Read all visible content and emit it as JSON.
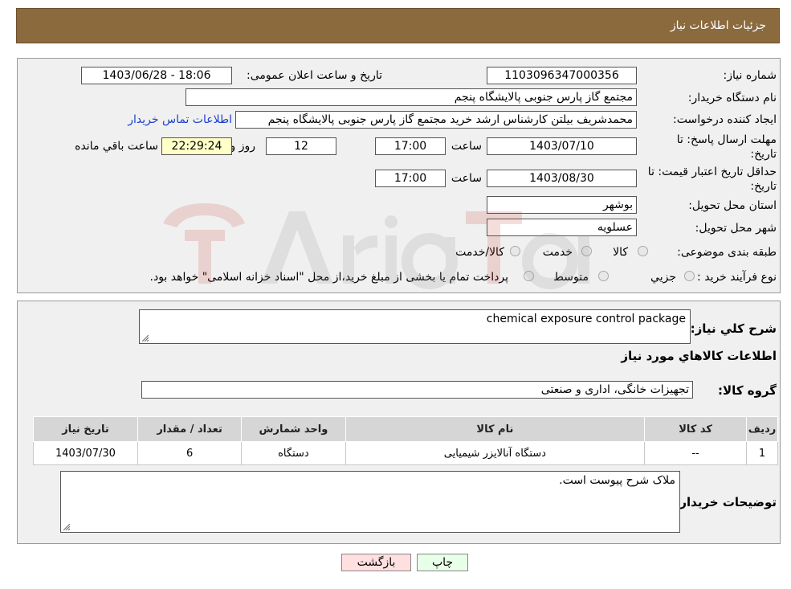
{
  "header": {
    "title": "جزئیات اطلاعات نیاز"
  },
  "form": {
    "need_number_label": "شماره نیاز:",
    "need_number": "1103096347000356",
    "announce_label": "تاریخ و ساعت اعلان عمومی:",
    "announce_value": "1403/06/28 - 18:06",
    "buyer_org_label": "نام دستگاه خریدار:",
    "buyer_org": "مجتمع گاز پارس جنوبی  پالایشگاه پنجم",
    "requester_label": "ایجاد کننده درخواست:",
    "requester": "محمدشریف بیلتن کارشناس ارشد خرید مجتمع گاز پارس جنوبی  پالایشگاه پنجم",
    "contact_link": "اطلاعات تماس خریدار",
    "deadline_label_1": "مهلت ارسال پاسخ: تا",
    "deadline_label_2": "تاریخ:",
    "deadline_date": "1403/07/10",
    "time_label": "ساعت",
    "deadline_time": "17:00",
    "days_value": "12",
    "days_label": "روز و",
    "remaining_time": "22:29:24",
    "remaining_label": "ساعت باقي مانده",
    "validity_label_1": "حداقل تاریخ اعتبار قیمت: تا",
    "validity_label_2": "تاریخ:",
    "validity_date": "1403/08/30",
    "validity_time": "17:00",
    "province_label": "استان محل تحویل:",
    "province": "بوشهر",
    "city_label": "شهر محل تحویل:",
    "city": "عسلویه",
    "category_label": "طبقه بندی موضوعی:",
    "category_options": [
      "کالا",
      "خدمت",
      "کالا/خدمت"
    ],
    "purchase_label": "نوع فرآیند خرید :",
    "purchase_options": [
      "جزيي",
      "متوسط"
    ],
    "purchase_note": "پرداخت تمام یا بخشی از مبلغ خرید،از محل \"اسناد خزانه اسلامی\" خواهد بود."
  },
  "details": {
    "desc_label": "شرح كلي نياز:",
    "desc_value": "chemical exposure control package",
    "goods_info_title": "اطلاعات كالاهاي مورد نياز",
    "group_label": "گروه كالا:",
    "group_value": "تجهيزات خانگی، اداری و صنعتی",
    "table": {
      "headers": [
        "رديف",
        "كد كالا",
        "نام كالا",
        "واحد شمارش",
        "تعداد / مقدار",
        "تاريخ نياز"
      ],
      "rows": [
        [
          "1",
          "--",
          "دستگاه آنالایزر شیمیایی",
          "دستگاه",
          "6",
          "1403/07/30"
        ]
      ]
    },
    "buyer_notes_label": "توضيحات خريدار:",
    "buyer_notes": "ملاک شرح پیوست است."
  },
  "buttons": {
    "print": "چاپ",
    "back": "بازگشت"
  },
  "colors": {
    "header_bg": "#8b6a3e",
    "link": "#1a3fd0",
    "remaining_bg": "#ffffc8",
    "back_bg": "#ffdfdf",
    "print_bg": "#e8ffe8"
  }
}
